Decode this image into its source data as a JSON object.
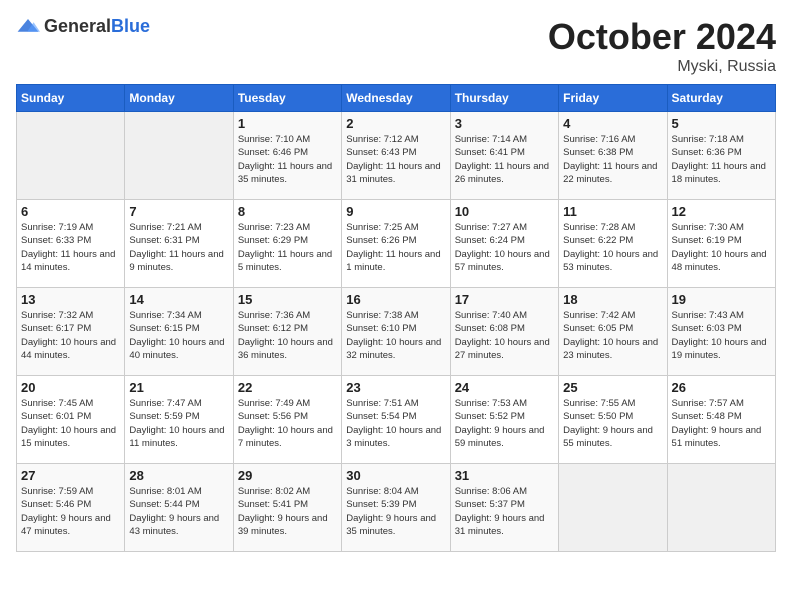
{
  "header": {
    "logo_general": "General",
    "logo_blue": "Blue",
    "month": "October 2024",
    "location": "Myski, Russia"
  },
  "days_of_week": [
    "Sunday",
    "Monday",
    "Tuesday",
    "Wednesday",
    "Thursday",
    "Friday",
    "Saturday"
  ],
  "weeks": [
    [
      {
        "day": "",
        "sunrise": "",
        "sunset": "",
        "daylight": ""
      },
      {
        "day": "",
        "sunrise": "",
        "sunset": "",
        "daylight": ""
      },
      {
        "day": "1",
        "sunrise": "Sunrise: 7:10 AM",
        "sunset": "Sunset: 6:46 PM",
        "daylight": "Daylight: 11 hours and 35 minutes."
      },
      {
        "day": "2",
        "sunrise": "Sunrise: 7:12 AM",
        "sunset": "Sunset: 6:43 PM",
        "daylight": "Daylight: 11 hours and 31 minutes."
      },
      {
        "day": "3",
        "sunrise": "Sunrise: 7:14 AM",
        "sunset": "Sunset: 6:41 PM",
        "daylight": "Daylight: 11 hours and 26 minutes."
      },
      {
        "day": "4",
        "sunrise": "Sunrise: 7:16 AM",
        "sunset": "Sunset: 6:38 PM",
        "daylight": "Daylight: 11 hours and 22 minutes."
      },
      {
        "day": "5",
        "sunrise": "Sunrise: 7:18 AM",
        "sunset": "Sunset: 6:36 PM",
        "daylight": "Daylight: 11 hours and 18 minutes."
      }
    ],
    [
      {
        "day": "6",
        "sunrise": "Sunrise: 7:19 AM",
        "sunset": "Sunset: 6:33 PM",
        "daylight": "Daylight: 11 hours and 14 minutes."
      },
      {
        "day": "7",
        "sunrise": "Sunrise: 7:21 AM",
        "sunset": "Sunset: 6:31 PM",
        "daylight": "Daylight: 11 hours and 9 minutes."
      },
      {
        "day": "8",
        "sunrise": "Sunrise: 7:23 AM",
        "sunset": "Sunset: 6:29 PM",
        "daylight": "Daylight: 11 hours and 5 minutes."
      },
      {
        "day": "9",
        "sunrise": "Sunrise: 7:25 AM",
        "sunset": "Sunset: 6:26 PM",
        "daylight": "Daylight: 11 hours and 1 minute."
      },
      {
        "day": "10",
        "sunrise": "Sunrise: 7:27 AM",
        "sunset": "Sunset: 6:24 PM",
        "daylight": "Daylight: 10 hours and 57 minutes."
      },
      {
        "day": "11",
        "sunrise": "Sunrise: 7:28 AM",
        "sunset": "Sunset: 6:22 PM",
        "daylight": "Daylight: 10 hours and 53 minutes."
      },
      {
        "day": "12",
        "sunrise": "Sunrise: 7:30 AM",
        "sunset": "Sunset: 6:19 PM",
        "daylight": "Daylight: 10 hours and 48 minutes."
      }
    ],
    [
      {
        "day": "13",
        "sunrise": "Sunrise: 7:32 AM",
        "sunset": "Sunset: 6:17 PM",
        "daylight": "Daylight: 10 hours and 44 minutes."
      },
      {
        "day": "14",
        "sunrise": "Sunrise: 7:34 AM",
        "sunset": "Sunset: 6:15 PM",
        "daylight": "Daylight: 10 hours and 40 minutes."
      },
      {
        "day": "15",
        "sunrise": "Sunrise: 7:36 AM",
        "sunset": "Sunset: 6:12 PM",
        "daylight": "Daylight: 10 hours and 36 minutes."
      },
      {
        "day": "16",
        "sunrise": "Sunrise: 7:38 AM",
        "sunset": "Sunset: 6:10 PM",
        "daylight": "Daylight: 10 hours and 32 minutes."
      },
      {
        "day": "17",
        "sunrise": "Sunrise: 7:40 AM",
        "sunset": "Sunset: 6:08 PM",
        "daylight": "Daylight: 10 hours and 27 minutes."
      },
      {
        "day": "18",
        "sunrise": "Sunrise: 7:42 AM",
        "sunset": "Sunset: 6:05 PM",
        "daylight": "Daylight: 10 hours and 23 minutes."
      },
      {
        "day": "19",
        "sunrise": "Sunrise: 7:43 AM",
        "sunset": "Sunset: 6:03 PM",
        "daylight": "Daylight: 10 hours and 19 minutes."
      }
    ],
    [
      {
        "day": "20",
        "sunrise": "Sunrise: 7:45 AM",
        "sunset": "Sunset: 6:01 PM",
        "daylight": "Daylight: 10 hours and 15 minutes."
      },
      {
        "day": "21",
        "sunrise": "Sunrise: 7:47 AM",
        "sunset": "Sunset: 5:59 PM",
        "daylight": "Daylight: 10 hours and 11 minutes."
      },
      {
        "day": "22",
        "sunrise": "Sunrise: 7:49 AM",
        "sunset": "Sunset: 5:56 PM",
        "daylight": "Daylight: 10 hours and 7 minutes."
      },
      {
        "day": "23",
        "sunrise": "Sunrise: 7:51 AM",
        "sunset": "Sunset: 5:54 PM",
        "daylight": "Daylight: 10 hours and 3 minutes."
      },
      {
        "day": "24",
        "sunrise": "Sunrise: 7:53 AM",
        "sunset": "Sunset: 5:52 PM",
        "daylight": "Daylight: 9 hours and 59 minutes."
      },
      {
        "day": "25",
        "sunrise": "Sunrise: 7:55 AM",
        "sunset": "Sunset: 5:50 PM",
        "daylight": "Daylight: 9 hours and 55 minutes."
      },
      {
        "day": "26",
        "sunrise": "Sunrise: 7:57 AM",
        "sunset": "Sunset: 5:48 PM",
        "daylight": "Daylight: 9 hours and 51 minutes."
      }
    ],
    [
      {
        "day": "27",
        "sunrise": "Sunrise: 7:59 AM",
        "sunset": "Sunset: 5:46 PM",
        "daylight": "Daylight: 9 hours and 47 minutes."
      },
      {
        "day": "28",
        "sunrise": "Sunrise: 8:01 AM",
        "sunset": "Sunset: 5:44 PM",
        "daylight": "Daylight: 9 hours and 43 minutes."
      },
      {
        "day": "29",
        "sunrise": "Sunrise: 8:02 AM",
        "sunset": "Sunset: 5:41 PM",
        "daylight": "Daylight: 9 hours and 39 minutes."
      },
      {
        "day": "30",
        "sunrise": "Sunrise: 8:04 AM",
        "sunset": "Sunset: 5:39 PM",
        "daylight": "Daylight: 9 hours and 35 minutes."
      },
      {
        "day": "31",
        "sunrise": "Sunrise: 8:06 AM",
        "sunset": "Sunset: 5:37 PM",
        "daylight": "Daylight: 9 hours and 31 minutes."
      },
      {
        "day": "",
        "sunrise": "",
        "sunset": "",
        "daylight": ""
      },
      {
        "day": "",
        "sunrise": "",
        "sunset": "",
        "daylight": ""
      }
    ]
  ]
}
